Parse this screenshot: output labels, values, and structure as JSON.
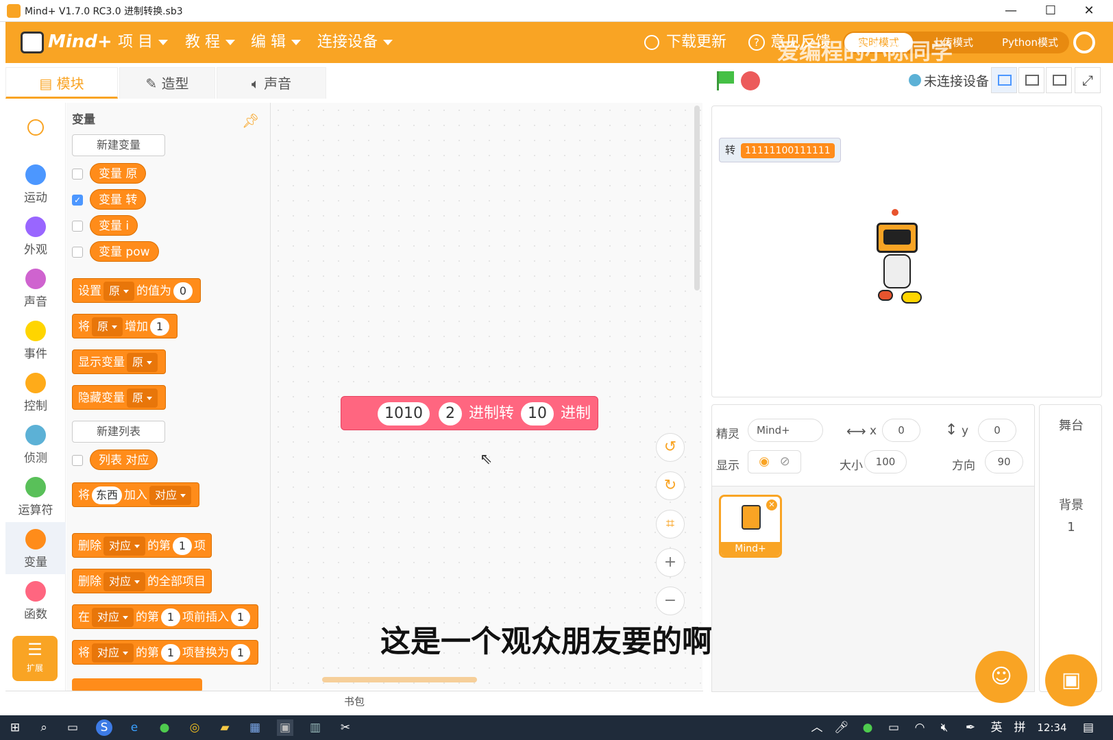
{
  "window": {
    "title": "Mind+ V1.7.0 RC3.0    进制转换.sb3",
    "minimize": "—",
    "maximize": "☐",
    "close": "✕"
  },
  "menu": {
    "items": [
      "项 目",
      "教 程",
      "编 辑",
      "连接设备"
    ],
    "download": "下载更新",
    "feedback": "意见反馈",
    "mode_left": "实时模式",
    "mode_right": "上传模式",
    "python": "Python模式",
    "watermark": "爱编程的小陈同学"
  },
  "tabs": {
    "blocks": "模块",
    "costumes": "造型",
    "sounds": "声音"
  },
  "connection_status": "未连接设备",
  "categories": [
    {
      "label": "运动",
      "color": "#4c97ff"
    },
    {
      "label": "外观",
      "color": "#9966ff"
    },
    {
      "label": "声音",
      "color": "#cf63cf"
    },
    {
      "label": "事件",
      "color": "#ffd500"
    },
    {
      "label": "控制",
      "color": "#ffab19"
    },
    {
      "label": "侦测",
      "color": "#5cb1d6"
    },
    {
      "label": "运算符",
      "color": "#59c059"
    },
    {
      "label": "变量",
      "color": "#ff8c1a"
    },
    {
      "label": "函数",
      "color": "#ff6680"
    }
  ],
  "extension_label": "扩展",
  "palette": {
    "title": "变量",
    "new_variable": "新建变量",
    "var_prefix": "变量",
    "variables": [
      "原",
      "转",
      "i",
      "pow"
    ],
    "checked": [
      false,
      true,
      false,
      false
    ],
    "set_block": {
      "a": "设置",
      "var": "原",
      "b": "的值为",
      "val": "0"
    },
    "change_block": {
      "a": "将",
      "var": "原",
      "b": "增加",
      "val": "1"
    },
    "show_block": {
      "a": "显示变量",
      "var": "原"
    },
    "hide_block": {
      "a": "隐藏变量",
      "var": "原"
    },
    "new_list": "新建列表",
    "list_prefix": "列表",
    "list_name": "对应",
    "add_block": {
      "a": "将",
      "item": "东西",
      "b": "加入",
      "list": "对应"
    },
    "delete_block": {
      "a": "删除",
      "list": "对应",
      "b": "的第",
      "val": "1",
      "c": "项"
    },
    "delete_all_block": {
      "a": "删除",
      "list": "对应",
      "b": "的全部项目"
    },
    "insert_block": {
      "a": "在",
      "list": "对应",
      "b": "的第",
      "val": "1",
      "c": "项前插入",
      "val2": "1"
    },
    "replace_block": {
      "a": "将",
      "list": "对应",
      "b": "的第",
      "val": "1",
      "c": "项替换为",
      "val2": "1"
    }
  },
  "script_block": {
    "input": "1010",
    "from": "2",
    "mid": "进制转",
    "to": "10",
    "end": "进制"
  },
  "stage": {
    "monitor_label": "转",
    "monitor_value": "11111100111111"
  },
  "sprite_info": {
    "sprite_label": "精灵",
    "sprite_name": "Mind+",
    "x_label": "x",
    "x": "0",
    "y_label": "y",
    "y": "0",
    "show_label": "显示",
    "size_label": "大小",
    "size": "100",
    "direction_label": "方向",
    "direction": "90"
  },
  "sprite_list": [
    {
      "name": "Mind+"
    }
  ],
  "stage_panel": {
    "title": "舞台",
    "backdrop_label": "背景",
    "backdrop_count": "1"
  },
  "bag": "书包",
  "subtitle": "这是一个观众朋友要的啊",
  "taskbar": {
    "ime_lang": "英",
    "ime_mode": "拼",
    "clock": "12:34"
  }
}
